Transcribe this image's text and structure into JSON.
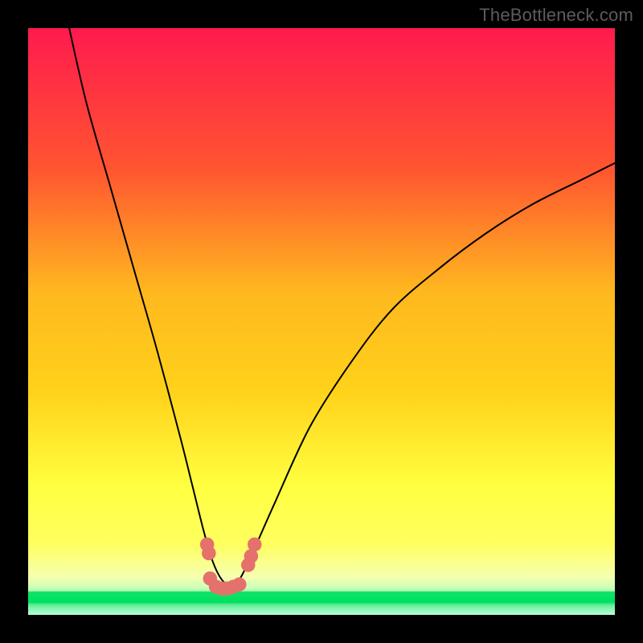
{
  "watermark": "TheBottleneck.com",
  "chart_data": {
    "type": "line",
    "title": "",
    "xlabel": "",
    "ylabel": "",
    "xlim": [
      0,
      100
    ],
    "ylim": [
      0,
      100
    ],
    "grid": false,
    "legend": false,
    "background_gradient": {
      "top_color": "#ff1a4e",
      "upper_mid_color": "#ff6a2a",
      "mid_color": "#ffd21a",
      "lower_mid_color": "#ffff60",
      "near_bottom_color": "#f6ffb0",
      "bottom_accent_color": "#00e060"
    },
    "series": [
      {
        "name": "bottleneck-curve",
        "color": "#000000",
        "x": [
          7,
          10,
          14,
          18,
          22,
          26,
          28,
          30,
          31.5,
          33,
          34.5,
          36,
          38,
          42,
          48,
          55,
          62,
          70,
          78,
          86,
          94,
          100
        ],
        "y": [
          100,
          87,
          73,
          59,
          45,
          30,
          22,
          14,
          9,
          6,
          5,
          6,
          10,
          19,
          32,
          43,
          52,
          59,
          65,
          70,
          74,
          77
        ]
      }
    ],
    "markers": {
      "name": "trough-cluster",
      "color": "#e4716c",
      "radius": 1.2,
      "points": [
        {
          "x": 30.5,
          "y": 12.0
        },
        {
          "x": 30.8,
          "y": 10.5
        },
        {
          "x": 31.0,
          "y": 6.2
        },
        {
          "x": 32.0,
          "y": 4.8
        },
        {
          "x": 33.0,
          "y": 4.5
        },
        {
          "x": 34.0,
          "y": 4.5
        },
        {
          "x": 35.0,
          "y": 4.8
        },
        {
          "x": 36.0,
          "y": 5.2
        },
        {
          "x": 37.5,
          "y": 8.5
        },
        {
          "x": 38.0,
          "y": 10.0
        },
        {
          "x": 38.6,
          "y": 12.0
        }
      ]
    },
    "green_band": {
      "y_start": 2.0,
      "y_end": 4.0,
      "color": "#00e060"
    }
  }
}
